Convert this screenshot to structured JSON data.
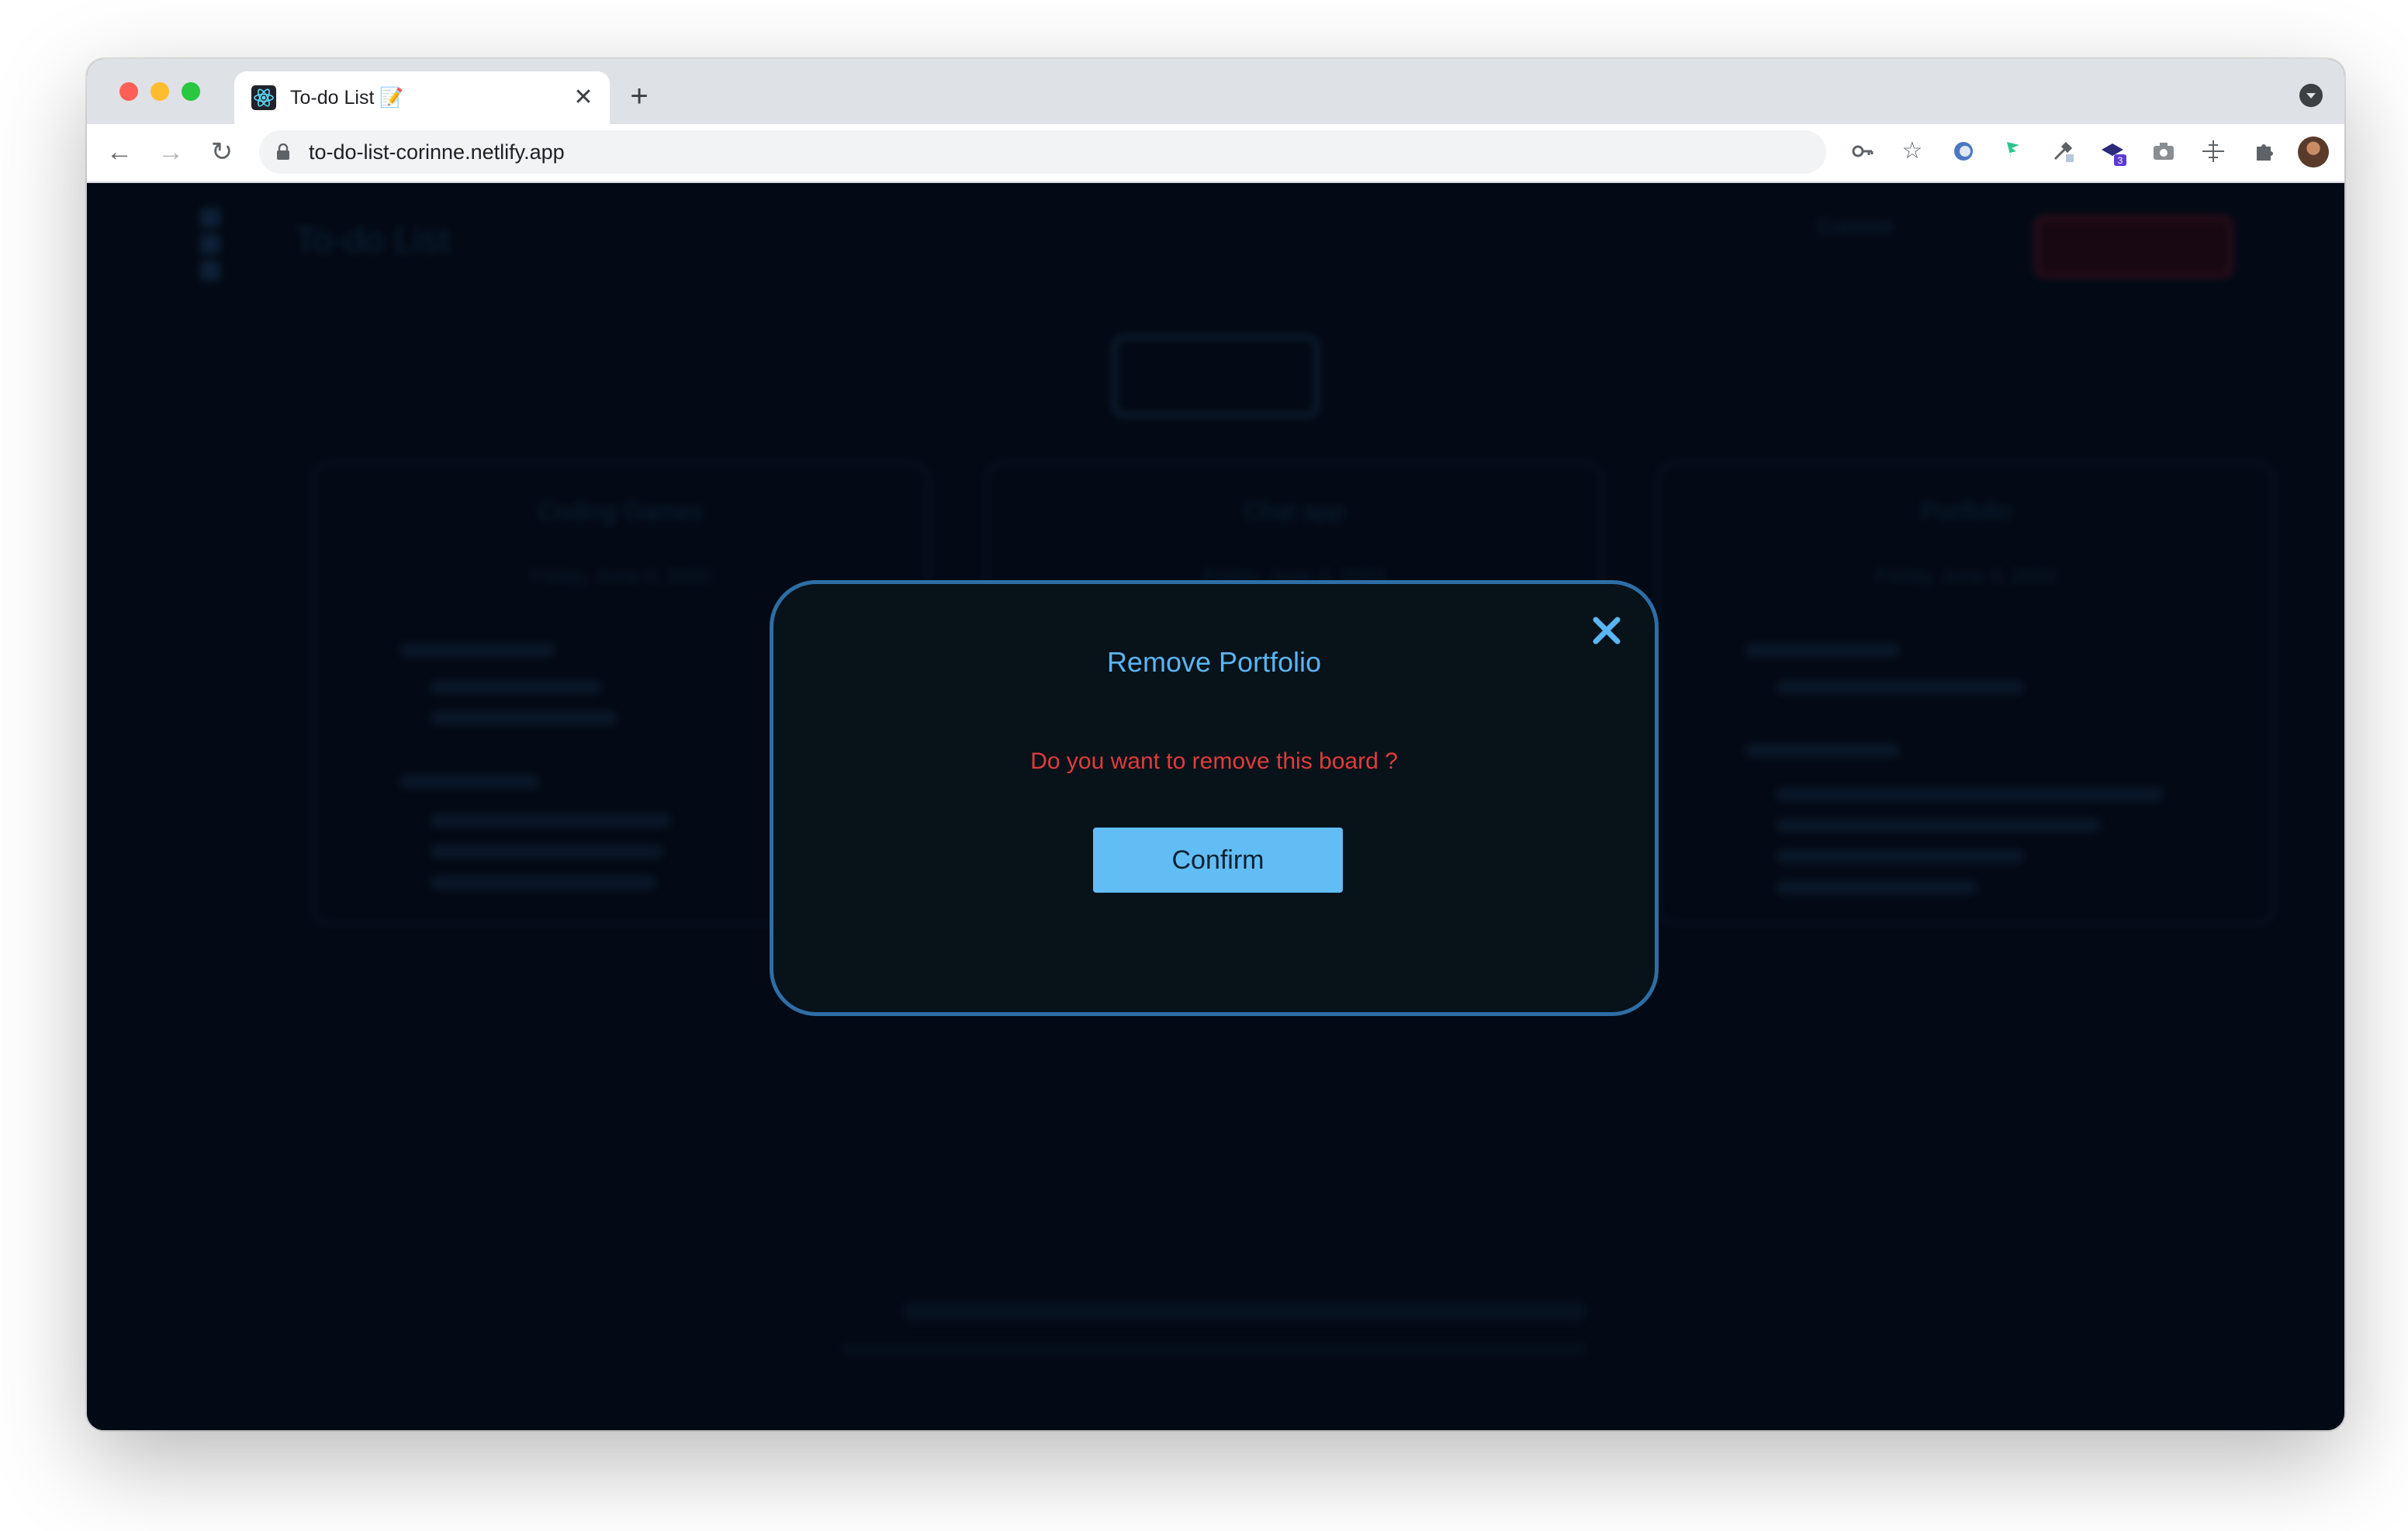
{
  "browser": {
    "tab_title": "To-do List 📝",
    "url": "to-do-list-corinne.netlify.app",
    "extension_badge": "3"
  },
  "background": {
    "app_title": "To-do List",
    "user_name": "Corinne",
    "boards": [
      {
        "title": "Coding Games",
        "date": "Friday, June 3, 2022"
      },
      {
        "title": "Chat app",
        "date": "Friday, June 3, 2022"
      },
      {
        "title": "Portfolio",
        "date": "Friday, June 3, 2022"
      }
    ]
  },
  "modal": {
    "title": "Remove Portfolio",
    "message": "Do you want to remove this board ?",
    "confirm_label": "Confirm"
  },
  "colors": {
    "accent": "#62bdf5",
    "danger": "#e03c3c",
    "modal_border": "#2d6ea6",
    "page_bg": "#030a15"
  }
}
